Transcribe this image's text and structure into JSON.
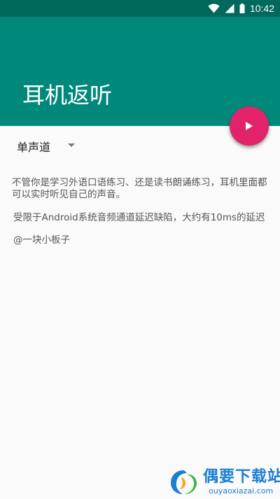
{
  "status_bar": {
    "time": "10:42",
    "icons": [
      "wifi-icon",
      "signal-icon",
      "battery-icon"
    ]
  },
  "app_bar": {
    "title": "耳机返听",
    "color": "#00897b",
    "status_color": "#00695c"
  },
  "fab": {
    "icon": "play-icon",
    "color": "#e2226a"
  },
  "channel_spinner": {
    "selected": "单声道",
    "icon": "dropdown-arrow-icon"
  },
  "content": {
    "description": "不管你是学习外语口语练习、还是读书朗诵练习，耳机里面都可以实时听见自己的声音。",
    "limitation": "受限于Android系统音频通道延迟缺陷，大约有10ms的延迟",
    "author": "@一块小板子"
  },
  "watermark": {
    "name": "偶要下载站",
    "domain": "ouyaoxiazai.com",
    "color": "#1b7fd1"
  }
}
